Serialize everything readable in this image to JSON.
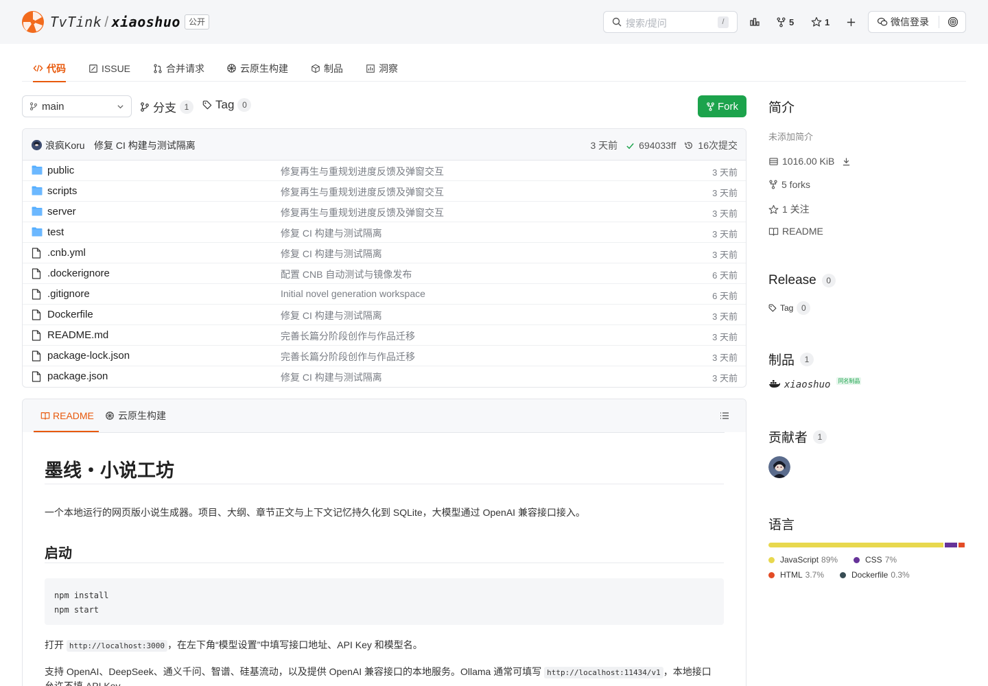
{
  "header": {
    "org": "TvTink",
    "separator": "/",
    "repo": "xiaoshuo",
    "visibility": "公开",
    "search_placeholder": "搜索/提问",
    "search_shortcut": "/",
    "fork_count": "5",
    "star_count": "1",
    "login_label": "微信登录"
  },
  "tabs": [
    {
      "label": "代码",
      "icon": "code-icon",
      "active": true
    },
    {
      "label": "ISSUE",
      "icon": "issue-icon"
    },
    {
      "label": "合并请求",
      "icon": "pull-request-icon"
    },
    {
      "label": "云原生构建",
      "icon": "build-icon"
    },
    {
      "label": "制品",
      "icon": "package-icon"
    },
    {
      "label": "洞察",
      "icon": "insights-icon"
    }
  ],
  "branch": {
    "current": "main",
    "branches_label": "分支",
    "branches_count": "1",
    "tags_label": "Tag",
    "tags_count": "0",
    "fork_label": "Fork"
  },
  "latest_commit": {
    "author": "浪疯Koru",
    "message": "修复 CI 构建与测试隔离",
    "time": "3 天前",
    "hash": "694033ff",
    "commit_count": "16次提交"
  },
  "files": [
    {
      "name": "public",
      "type": "folder",
      "message": "修复再生与重规划进度反馈及弹窗交互",
      "time": "3 天前"
    },
    {
      "name": "scripts",
      "type": "folder",
      "message": "修复再生与重规划进度反馈及弹窗交互",
      "time": "3 天前"
    },
    {
      "name": "server",
      "type": "folder",
      "message": "修复再生与重规划进度反馈及弹窗交互",
      "time": "3 天前"
    },
    {
      "name": "test",
      "type": "folder",
      "message": "修复 CI 构建与测试隔离",
      "time": "3 天前"
    },
    {
      "name": ".cnb.yml",
      "type": "file",
      "message": "修复 CI 构建与测试隔离",
      "time": "3 天前"
    },
    {
      "name": ".dockerignore",
      "type": "file",
      "message": "配置 CNB 自动测试与镜像发布",
      "time": "6 天前"
    },
    {
      "name": ".gitignore",
      "type": "file",
      "message": "Initial novel generation workspace",
      "time": "6 天前"
    },
    {
      "name": "Dockerfile",
      "type": "file",
      "message": "修复 CI 构建与测试隔离",
      "time": "3 天前"
    },
    {
      "name": "README.md",
      "type": "file",
      "message": "完善长篇分阶段创作与作品迁移",
      "time": "3 天前"
    },
    {
      "name": "package-lock.json",
      "type": "file",
      "message": "完善长篇分阶段创作与作品迁移",
      "time": "3 天前"
    },
    {
      "name": "package.json",
      "type": "file",
      "message": "修复 CI 构建与测试隔离",
      "time": "3 天前"
    }
  ],
  "readme": {
    "tab_readme": "README",
    "tab_build": "云原生构建",
    "h1": "墨线・小说工坊",
    "intro": "一个本地运行的网页版小说生成器。项目、大纲、章节正文与上下文记忆持久化到 SQLite，大模型通过 OpenAI 兼容接口接入。",
    "h2": "启动",
    "code_lines": [
      "npm install",
      "npm start"
    ],
    "p2_before": "打开 ",
    "p2_code": "http://localhost:3000",
    "p2_after": "，在左下角“模型设置”中填写接口地址、API Key 和模型名。",
    "p3_before": "支持 OpenAI、DeepSeek、通义千问、智谱、硅基流动，以及提供 OpenAI 兼容接口的本地服务。Ollama 通常可填写 ",
    "p3_code": "http://localhost:11434/v1",
    "p3_after": "，本地接口",
    "p4": "允许不填 API Key。"
  },
  "sidebar": {
    "about_title": "简介",
    "about_empty": "未添加简介",
    "size": "1016.00 KiB",
    "forks": "5 forks",
    "stars": "1 关注",
    "readme_link": "README",
    "release_title": "Release",
    "release_count": "0",
    "tag_label": "Tag",
    "tag_count": "0",
    "packages_title": "制品",
    "packages_count": "1",
    "package_name": "xiaoshuo",
    "package_badge": "同名制品",
    "contributors_title": "贡献者",
    "contributors_count": "1",
    "languages_title": "语言",
    "languages": [
      {
        "name": "JavaScript",
        "percent": "89%",
        "value": 89,
        "color": "#e8d84e"
      },
      {
        "name": "CSS",
        "percent": "7%",
        "value": 7,
        "color": "#663399"
      },
      {
        "name": "HTML",
        "percent": "3.7%",
        "value": 3.7,
        "color": "#e34c26"
      },
      {
        "name": "Dockerfile",
        "percent": "0.3%",
        "value": 0.3,
        "color": "#384d54"
      }
    ]
  },
  "colors": {
    "accent": "#e8590c",
    "fork_button": "#1ca34c",
    "folder": "#54aeff"
  }
}
